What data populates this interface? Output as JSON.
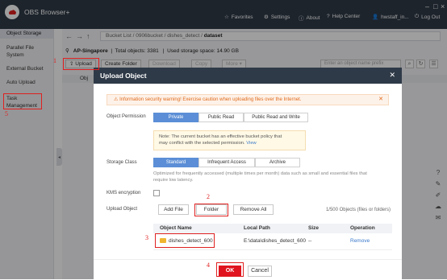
{
  "app": {
    "name": "OBS Browser+"
  },
  "titlebar": {
    "favorites": "Favorites",
    "settings": "Settings",
    "about": "About",
    "help": "Help Center",
    "user": "hwstaff_in...",
    "logout": "Log Out"
  },
  "sidebar": {
    "items": [
      {
        "label": "Object Storage"
      },
      {
        "label": "Parallel File System"
      },
      {
        "label": "External Bucket"
      },
      {
        "label": "Auto Upload"
      },
      {
        "label": "Task Management"
      }
    ]
  },
  "breadcrumb": {
    "prefix": "Bucket List / 0906bucket / dishes_detect / ",
    "current": "dataset"
  },
  "info": {
    "region": "AP-Singapore",
    "objects": "Total objects: 3381",
    "storage": "Used storage space: 14.90 GB"
  },
  "toolbar": {
    "upload": "Upload",
    "create_folder": "Create Folder",
    "download": "Download",
    "copy": "Copy",
    "more": "More"
  },
  "search": {
    "placeholder": "Enter an object name prefix"
  },
  "table_header": {
    "col1": "Obj"
  },
  "dialog": {
    "title": "Upload Object",
    "warning": "Information security warning! Exercise caution when uploading files over the Internet.",
    "permission_label": "Object Permission",
    "permissions": [
      "Private",
      "Public Read",
      "Public Read and Write"
    ],
    "note_line1": "Note: The current bucket has an effective bucket policy that",
    "note_line2": "may conflict with the selected permission.",
    "note_link": "View",
    "storage_label": "Storage Class",
    "storage_classes": [
      "Standard",
      "Infrequent Access",
      "Archive"
    ],
    "storage_hint1": "Optimized for frequently accessed (multiple times per month) data such as small and essential files that",
    "storage_hint2": "require low latency.",
    "kms_label": "KMS encryption",
    "upload_label": "Upload Object",
    "add_file": "Add File",
    "folder": "Folder",
    "remove_all": "Remove All",
    "count": "1/500 Objects (files or folders)",
    "columns": [
      "Object Name",
      "Local Path",
      "Size",
      "Operation"
    ],
    "rows": [
      {
        "name": "dishes_detect_600",
        "path": "E:\\data\\dishes_detect_600",
        "size": "--",
        "op": "Remove"
      }
    ],
    "ok": "OK",
    "cancel": "Cancel"
  },
  "annotations": [
    "1",
    "2",
    "3",
    "4",
    "5"
  ],
  "colors": {
    "header": "#2f3a48",
    "accent": "#5b8ed6",
    "ok": "#e0141e",
    "annotation": "#e02020"
  }
}
